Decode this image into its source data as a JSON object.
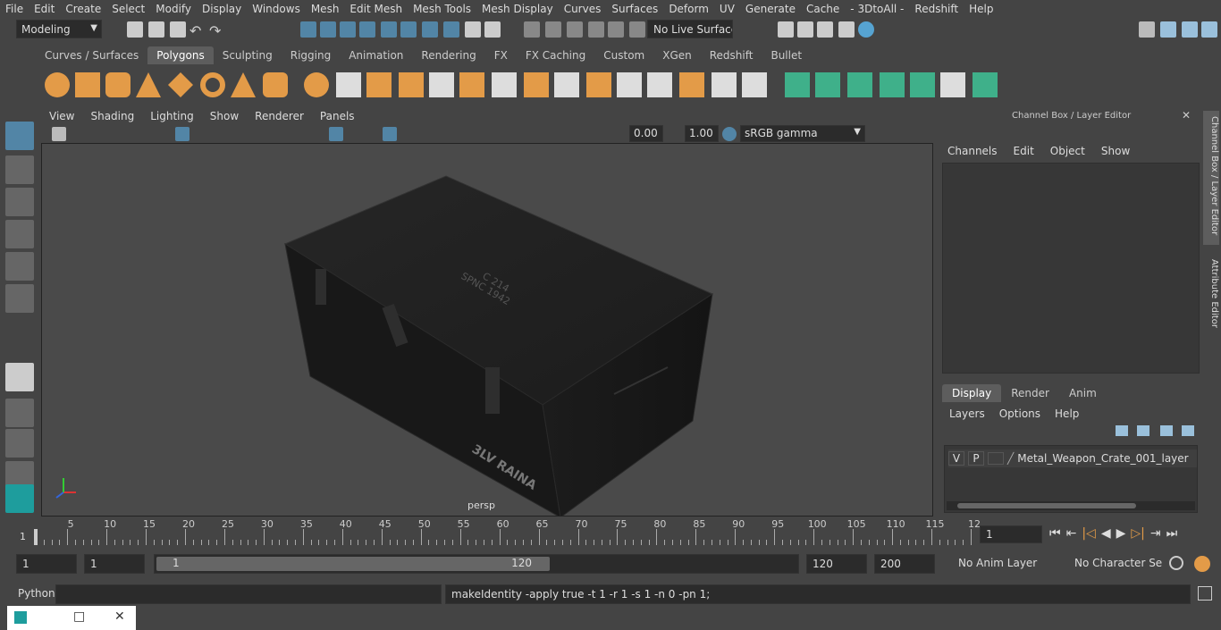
{
  "menubar": [
    "File",
    "Edit",
    "Create",
    "Select",
    "Modify",
    "Display",
    "Windows",
    "Mesh",
    "Edit Mesh",
    "Mesh Tools",
    "Mesh Display",
    "Curves",
    "Surfaces",
    "Deform",
    "UV",
    "Generate",
    "Cache",
    "- 3DtoAll -",
    "Redshift",
    "Help"
  ],
  "status": {
    "mode": "Modeling",
    "live_surface": "No Live Surface"
  },
  "shelf_tabs": [
    "Curves / Surfaces",
    "Polygons",
    "Sculpting",
    "Rigging",
    "Animation",
    "Rendering",
    "FX",
    "FX Caching",
    "Custom",
    "XGen",
    "Redshift",
    "Bullet"
  ],
  "shelf_active": "Polygons",
  "panel_menu": [
    "View",
    "Shading",
    "Lighting",
    "Show",
    "Renderer",
    "Panels"
  ],
  "view_tools": {
    "exposure": "0.00",
    "gamma": "1.00",
    "color_space": "sRGB gamma"
  },
  "viewport": {
    "camera_label": "persp",
    "crate_text_1": "C 214",
    "crate_text_2": "SPNC 1942",
    "crate_text_3": "3LV RAINA"
  },
  "channel_box": {
    "title": "Channel Box / Layer Editor",
    "menu": [
      "Channels",
      "Edit",
      "Object",
      "Show"
    ]
  },
  "layer_editor": {
    "tabs": [
      "Display",
      "Render",
      "Anim"
    ],
    "active_tab": "Display",
    "menu": [
      "Layers",
      "Options",
      "Help"
    ],
    "layer": {
      "v": "V",
      "p": "P",
      "name": "Metal_Weapon_Crate_001_layer"
    }
  },
  "side_tabs": {
    "channel_box": "Channel Box / Layer Editor",
    "attribute_editor": "Attribute Editor"
  },
  "timeline": {
    "ticks": [
      "5",
      "10",
      "15",
      "20",
      "25",
      "30",
      "35",
      "40",
      "45",
      "50",
      "55",
      "60",
      "65",
      "70",
      "75",
      "80",
      "85",
      "90",
      "95",
      "100",
      "105",
      "110",
      "115",
      "12"
    ],
    "start_frame": "1",
    "current_frame": "1"
  },
  "range": {
    "start": "1",
    "anim_start": "1",
    "slider_start": "1",
    "slider_end": "120",
    "end": "120",
    "anim_end": "200",
    "anim_layer": "No Anim Layer",
    "char_set": "No Character Set"
  },
  "cmdline": {
    "label": "Python",
    "feedback": "makeIdentity -apply true -t 1 -r 1 -s 1 -n 0 -pn 1;"
  },
  "colors": {
    "bg": "#444444",
    "field": "#2b2b2b",
    "accent": "#5285a6",
    "shelf_orange": "#e39b48",
    "shelf_green": "#3fb08a"
  }
}
